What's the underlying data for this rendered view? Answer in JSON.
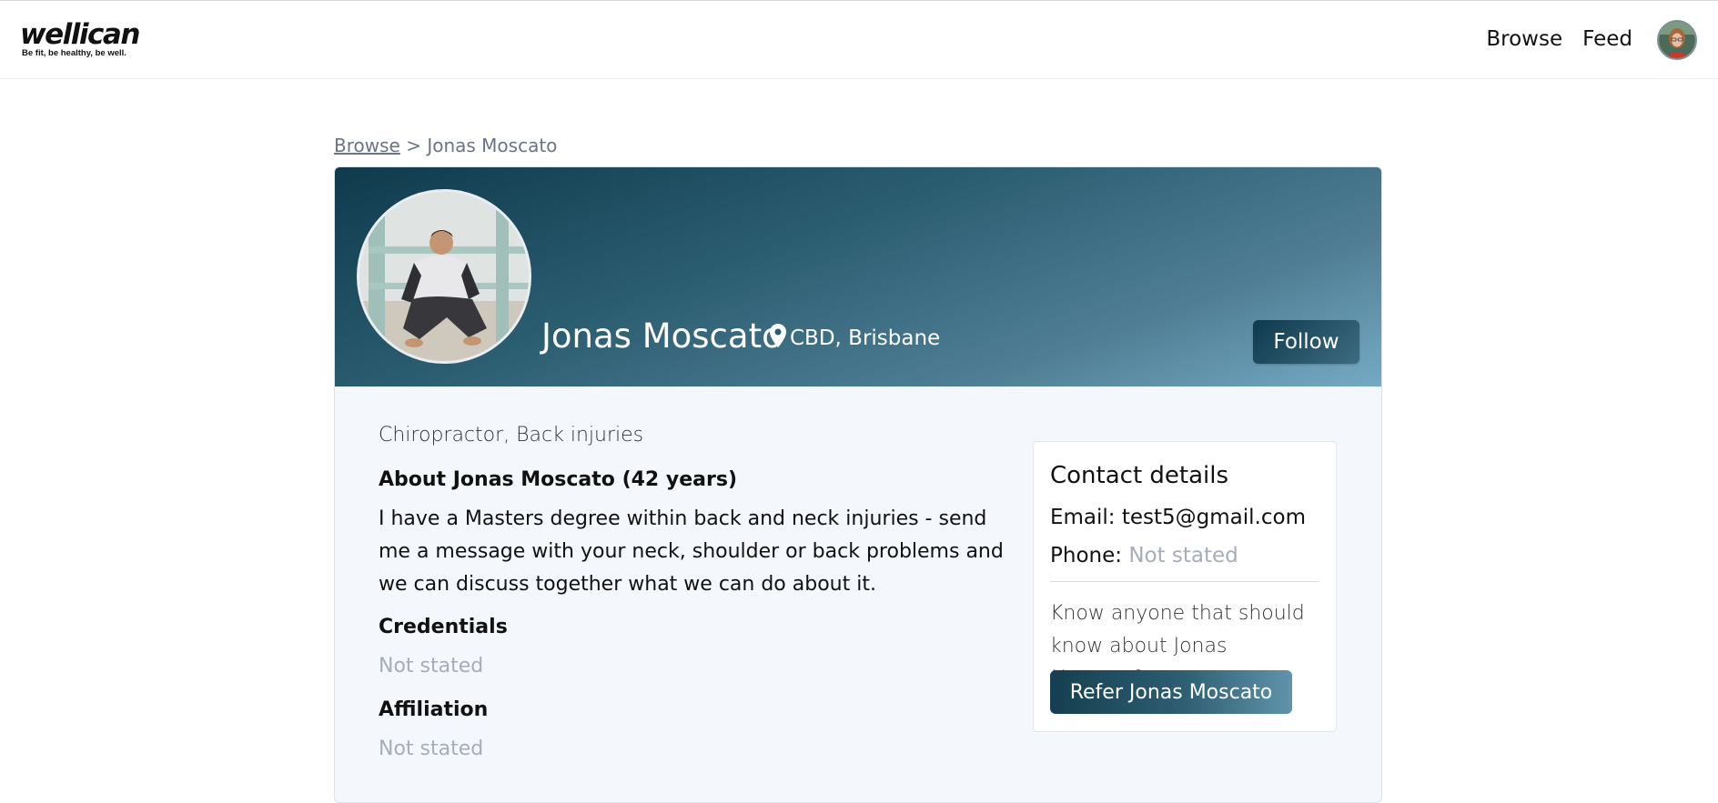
{
  "nav": {
    "logo_word": "wellican",
    "logo_tagline": "Be fit, be healthy, be well.",
    "links": [
      "Browse",
      "Feed"
    ]
  },
  "breadcrumb": {
    "parent": "Browse",
    "separator": ">",
    "current": "Jonas Moscato"
  },
  "profile": {
    "name": "Jonas Moscato",
    "location": "CBD, Brisbane",
    "follow_label": "Follow",
    "specialties": "Chiropractor, Back injuries",
    "about_heading": "About Jonas Moscato (42 years)",
    "about_text": "I have a Masters degree within back and neck injuries - send me a message with your neck, shoulder or back problems and we can discuss together what we can do about it.",
    "credentials_heading": "Credentials",
    "credentials_value": "Not stated",
    "affiliation_heading": "Affiliation",
    "affiliation_value": "Not stated"
  },
  "contact": {
    "title": "Contact details",
    "email_label": "Email:",
    "email_value": "test5@gmail.com",
    "phone_label": "Phone:",
    "phone_value": "Not stated",
    "refer_prompt": "Know anyone that should know about Jonas Moscato?",
    "refer_button": "Refer Jonas Moscato"
  },
  "colors": {
    "banner_dark": "#0f3a4c",
    "banner_light": "#75aac4",
    "muted_text": "#a7adb8"
  },
  "icons": [
    "map-pin-icon"
  ]
}
